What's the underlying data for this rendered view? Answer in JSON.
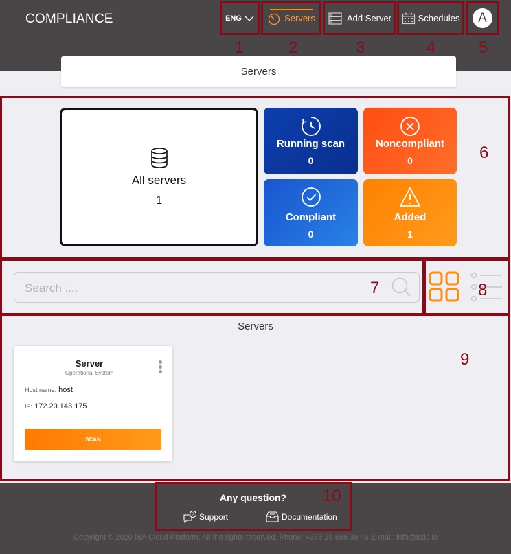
{
  "header": {
    "brand": "COMPLIANCE",
    "lang": "ENG",
    "nav": {
      "servers": "Servers",
      "add_server": "Add Server",
      "schedules": "Schedules"
    },
    "avatar_initial": "A"
  },
  "annotations": [
    "1",
    "2",
    "3",
    "4",
    "5",
    "6",
    "7",
    "8",
    "9",
    "10"
  ],
  "page_title": "Servers",
  "stats": {
    "all": {
      "label": "All servers",
      "value": "1"
    },
    "running": {
      "label": "Running scan",
      "value": "0",
      "color": "#0b3ba7"
    },
    "noncompliant": {
      "label": "Noncompliant",
      "value": "0",
      "color": "#ff5a1a"
    },
    "compliant": {
      "label": "Compliant",
      "value": "0",
      "color": "#1c62d6"
    },
    "added": {
      "label": "Added",
      "value": "1",
      "color": "#ff8c0f"
    }
  },
  "search": {
    "placeholder": "Search ...."
  },
  "list_title": "Servers",
  "card": {
    "title": "Server",
    "subtitle": "Operational System",
    "host_label": "Host name:",
    "host_value": "host",
    "ip_label": "IP:",
    "ip_value": "172.20.143.175",
    "scan_label": "SCAN"
  },
  "help": {
    "title": "Any question?",
    "support": "Support",
    "documentation": "Documentation"
  },
  "footer": "Copyright © 2020 IBA Cloud Platform. All the rights reserved. Phone: +375 29 686 39 46 E-mail: info@icdc.io",
  "accent": "#ff8c0f"
}
